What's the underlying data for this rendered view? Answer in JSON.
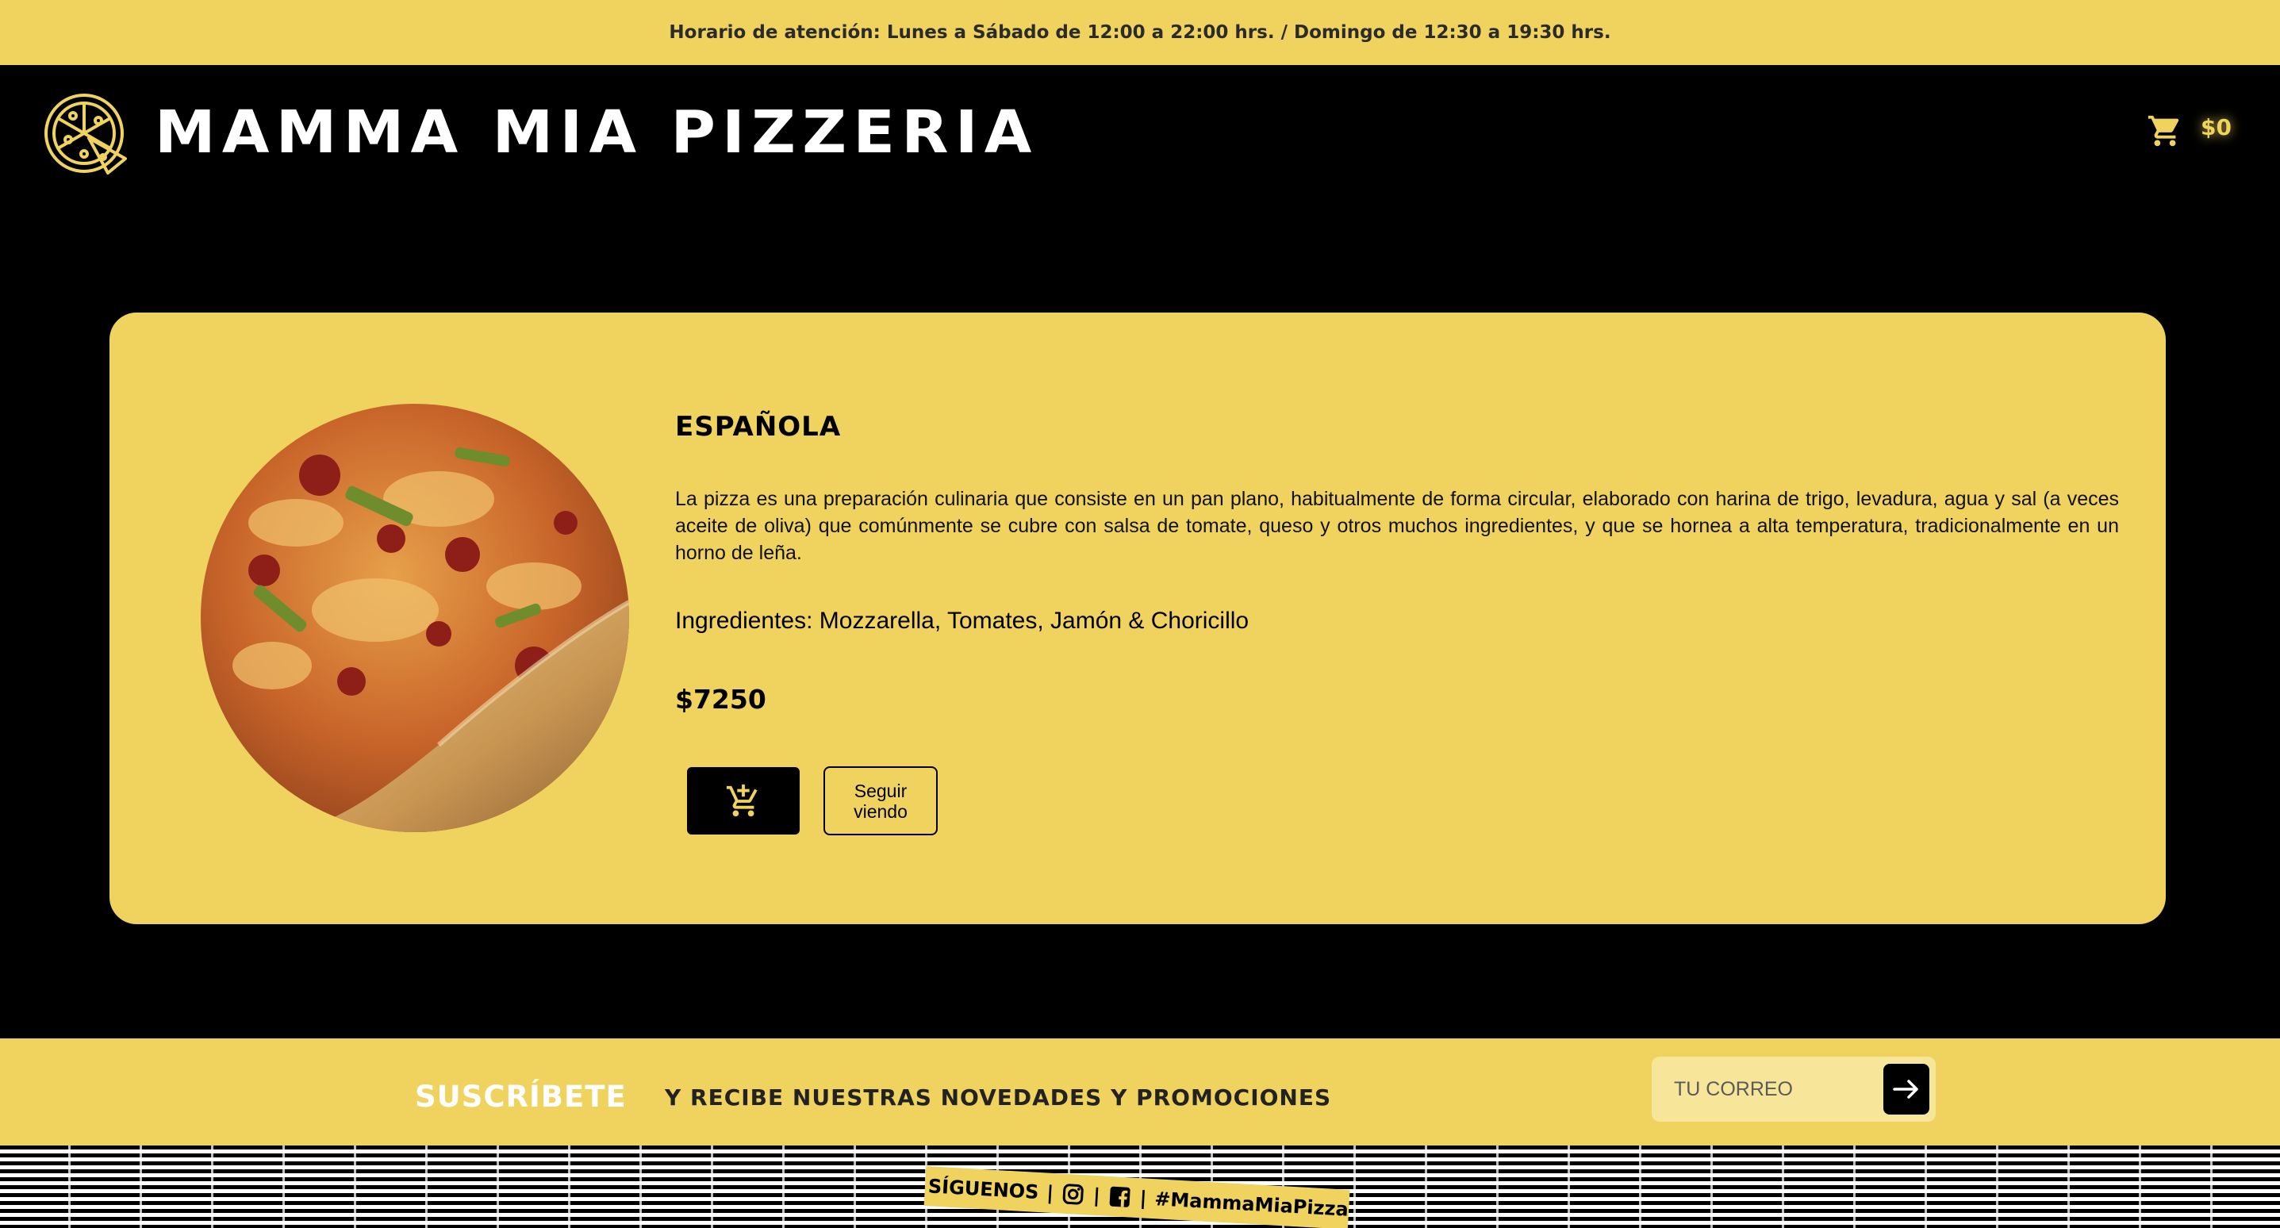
{
  "topbar": {
    "hours": "Horario de atención: Lunes a Sábado de 12:00 a 22:00 hrs. / Domingo de 12:30 a 19:30 hrs."
  },
  "header": {
    "brand": "MAMMA MIA PIZZERIA",
    "logo_icon": "pizza-icon",
    "cart_icon": "cart-icon",
    "cart_total": "$0"
  },
  "product": {
    "name": "ESPAÑOLA",
    "description": "La pizza es una preparación culinaria que consiste en un pan plano, habitualmente de forma circular, elaborado con harina de trigo, levadura, agua y sal (a veces aceite de oliva) que comúnmente se cubre con salsa de tomate, queso y otros muchos ingredientes, y que se hornea a alta temperatura, tradicionalmente en un horno de leña.",
    "ingredients": "Ingredientes: Mozzarella, Tomates, Jamón & Choricillo",
    "price": "$7250",
    "add_icon": "add-to-cart-icon",
    "more_label": "Seguir viendo"
  },
  "subscribe": {
    "title": "SUSCRÍBETE",
    "text": "Y RECIBE NUESTRAS NOVEDADES Y PROMOCIONES",
    "placeholder": "TU CORREO",
    "submit_icon": "arrow-right-icon"
  },
  "footer": {
    "follow": "SÍGUENOS",
    "sep": "|",
    "instagram_icon": "instagram-icon",
    "facebook_icon": "facebook-icon",
    "hashtag": "#MammaMiaPizza"
  },
  "colors": {
    "accent": "#efd35e",
    "background": "#000000",
    "text_dark": "#000000",
    "text_light": "#ffffff"
  }
}
